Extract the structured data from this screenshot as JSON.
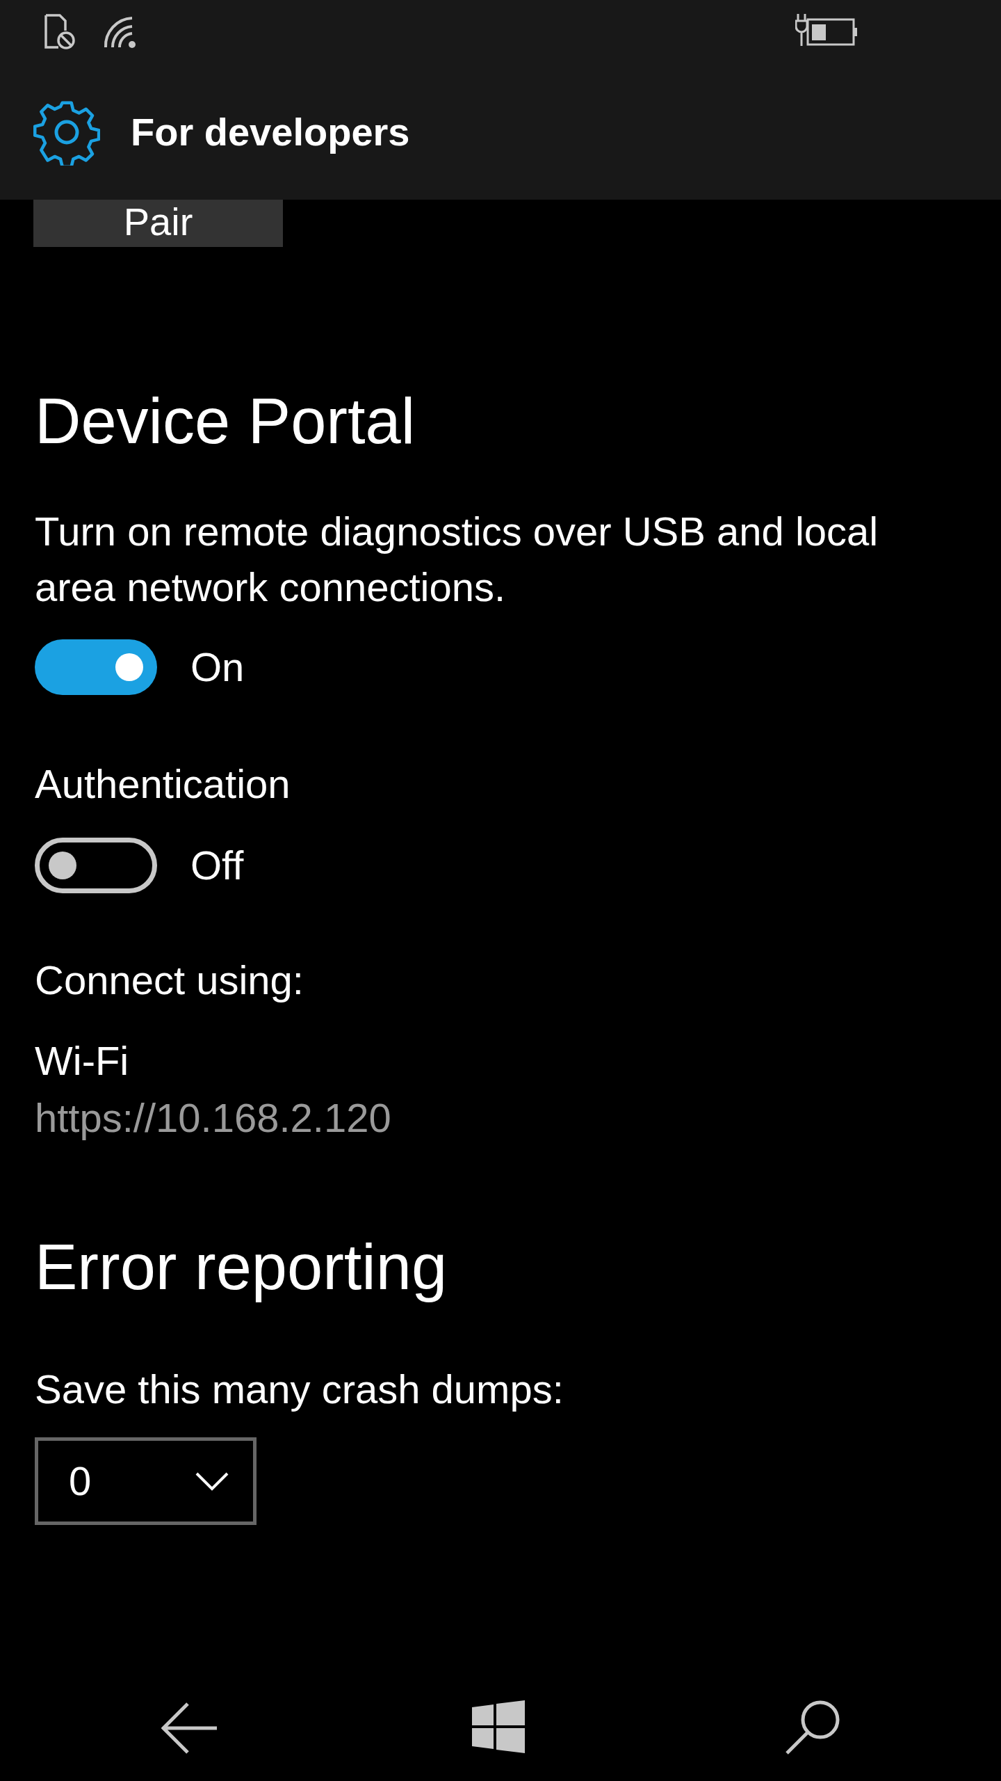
{
  "header": {
    "title": "For developers"
  },
  "pair_button": {
    "label": "Pair"
  },
  "device_portal": {
    "heading": "Device Portal",
    "description": "Turn on remote diagnostics over USB and local area network connections.",
    "toggles": [
      {
        "state_text": "On",
        "on": true
      },
      {
        "label": "Authentication",
        "state_text": "Off",
        "on": false
      }
    ],
    "connect_label": "Connect using:",
    "connection_type": "Wi-Fi",
    "url": "https://10.168.2.120"
  },
  "error_reporting": {
    "heading": "Error reporting",
    "label": "Save this many crash dumps:",
    "dropdown_value": "0"
  }
}
